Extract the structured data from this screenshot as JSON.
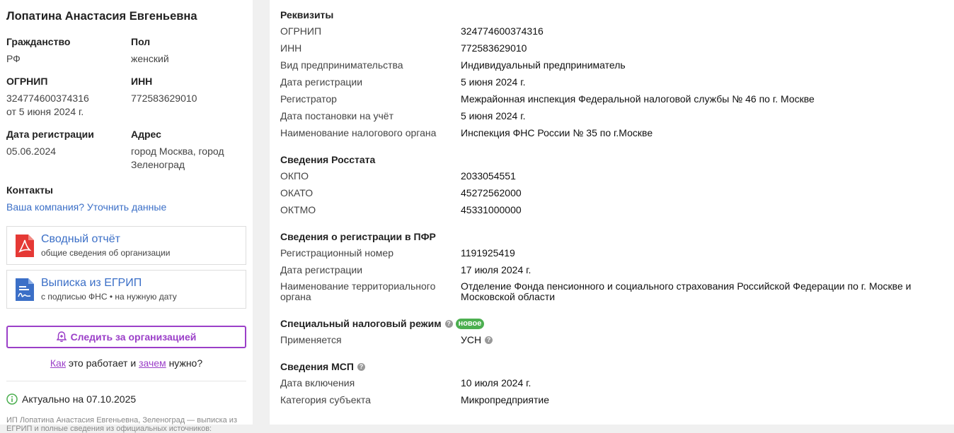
{
  "left": {
    "name": "Лопатина Анастасия Евгеньевна",
    "citizenship_label": "Гражданство",
    "citizenship_value": "РФ",
    "gender_label": "Пол",
    "gender_value": "женский",
    "ogrnip_label": "ОГРНИП",
    "ogrnip_value": "324774600374316",
    "ogrnip_date": "от 5 июня 2024 г.",
    "inn_label": "ИНН",
    "inn_value": "772583629010",
    "reg_date_label": "Дата регистрации",
    "reg_date_value": "05.06.2024",
    "address_label": "Адрес",
    "address_value": "город Москва, город Зеленоград",
    "contacts_label": "Контакты",
    "contacts_link": "Ваша компания? Уточнить данные",
    "cards": [
      {
        "title": "Сводный отчёт",
        "subtitle": "общие сведения об организации",
        "icon": "pdf-icon",
        "icon_color": "#e53935"
      },
      {
        "title": "Выписка из ЕГРИП",
        "subtitle": "с подписью ФНС • на нужную дату",
        "icon": "signed-document-icon",
        "icon_color": "#3b6fc7"
      }
    ],
    "follow_button": "Следить за организацией",
    "how_link": "Как",
    "how_middle": "это работает и",
    "why_link": "зачем",
    "how_end": "нужно?",
    "actual_text": "Актуально на 07.10.2025",
    "footnote": "ИП Лопатина Анастасия Евгеньевна, Зеленоград — выписка из ЕГРИП и полные сведения из официальных источников:"
  },
  "right": {
    "sections": [
      {
        "title": "Реквизиты",
        "rows": [
          {
            "k": "ОГРНИП",
            "v": "324774600374316"
          },
          {
            "k": "ИНН",
            "v": "772583629010"
          },
          {
            "k": "Вид предпринимательства",
            "v": "Индивидуальный предприниматель"
          },
          {
            "k": "Дата регистрации",
            "v": "5 июня 2024 г."
          },
          {
            "k": "Регистратор",
            "v": "Межрайонная инспекция Федеральной налоговой службы № 46 по г. Москве"
          },
          {
            "k": "Дата постановки на учёт",
            "v": "5 июня 2024 г."
          },
          {
            "k": "Наименование налогового органа",
            "v": "Инспекция ФНС России № 35 по г.Москве"
          }
        ]
      },
      {
        "title": "Сведения Росстата",
        "rows": [
          {
            "k": "ОКПО",
            "v": "2033054551"
          },
          {
            "k": "ОКАТО",
            "v": "45272562000"
          },
          {
            "k": "ОКТМО",
            "v": "45331000000"
          }
        ]
      },
      {
        "title": "Сведения о регистрации в ПФР",
        "rows": [
          {
            "k": "Регистрационный номер",
            "v": "1191925419"
          },
          {
            "k": "Дата регистрации",
            "v": "17 июля 2024 г."
          },
          {
            "k": "Наименование территориального органа",
            "v": "Отделение Фонда пенсионного и социального страхования Российской Федерации по г. Москве и Московской области"
          }
        ]
      },
      {
        "title": "Специальный налоговый режим",
        "badge": "новое",
        "rows": [
          {
            "k": "Применяется",
            "v": "УСН"
          }
        ]
      },
      {
        "title": "Сведения МСП",
        "rows": [
          {
            "k": "Дата включения",
            "v": "10 июля 2024 г."
          },
          {
            "k": "Категория субъекта",
            "v": "Микропредприятие"
          }
        ]
      }
    ]
  }
}
